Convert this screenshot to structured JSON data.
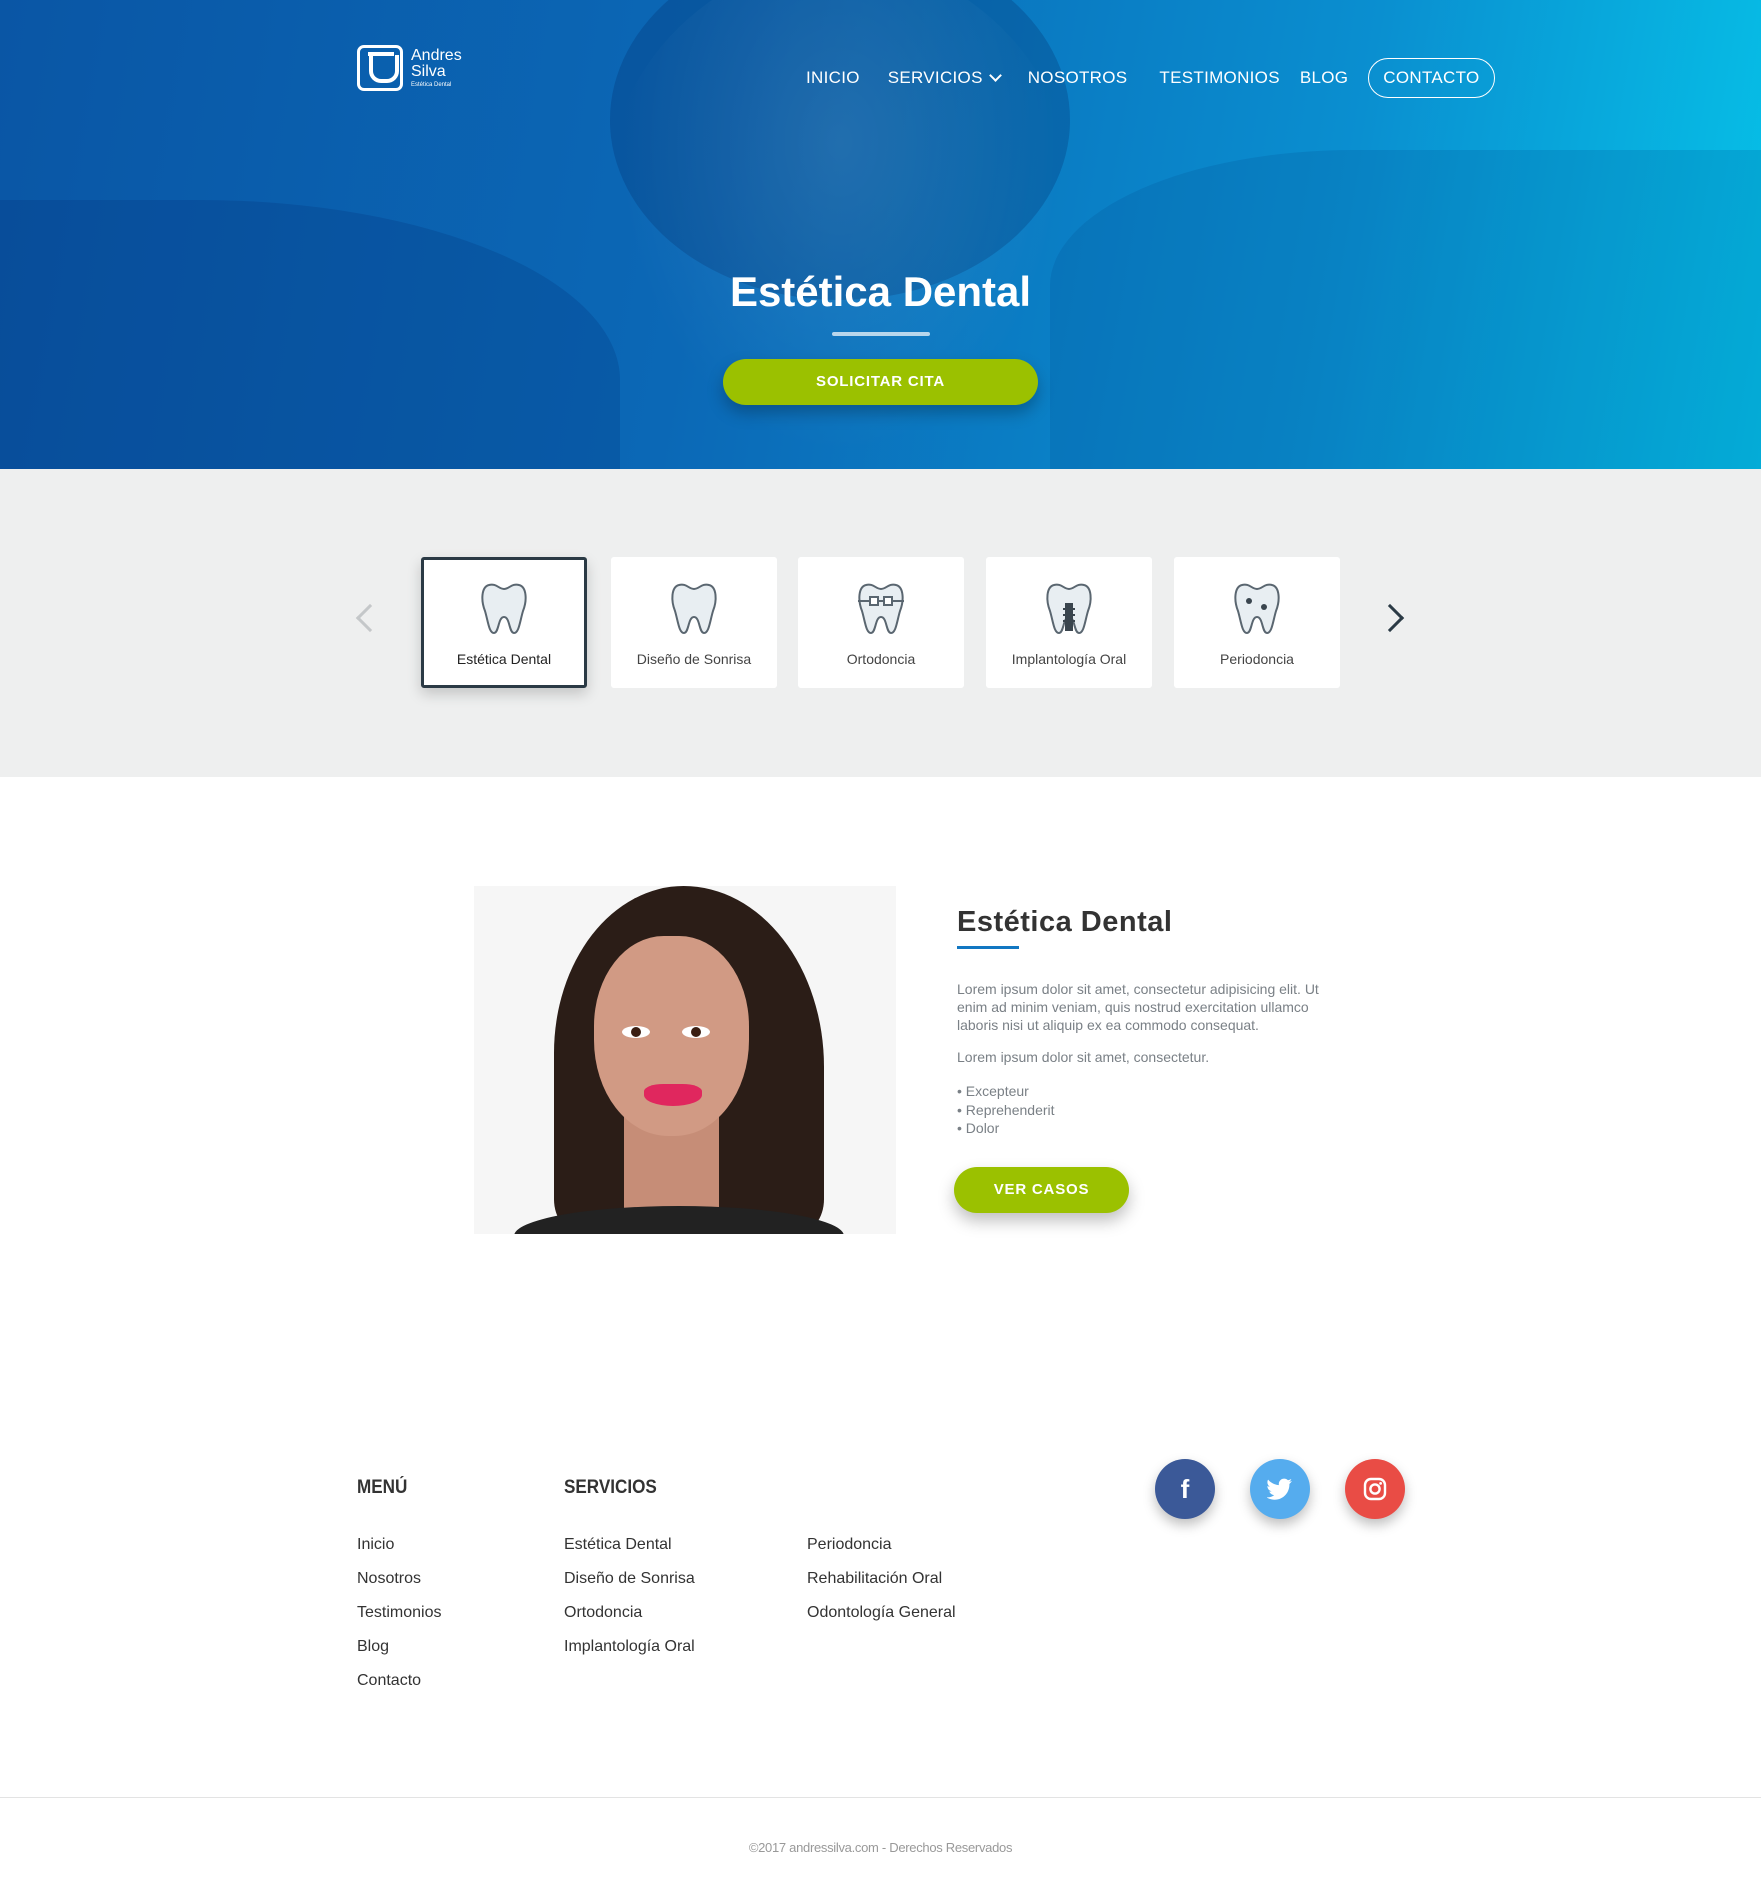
{
  "brand": {
    "line1": "Andres",
    "line2": "Silva",
    "line3": "Estética Dental"
  },
  "nav": {
    "items": [
      "INICIO",
      "SERVICIOS",
      "NOSOTROS",
      "TESTIMONIOS",
      "BLOG"
    ],
    "contact": "CONTACTO"
  },
  "hero": {
    "title": "Estética Dental",
    "button": "SOLICITAR CITA"
  },
  "services": {
    "active_index": 0,
    "cards": [
      {
        "label": "Estética Dental",
        "icon": "tooth-icon"
      },
      {
        "label": "Diseño de Sonrisa",
        "icon": "tooth-icon"
      },
      {
        "label": "Ortodoncia",
        "icon": "braces-tooth-icon"
      },
      {
        "label": "Implantología Oral",
        "icon": "implant-tooth-icon"
      },
      {
        "label": "Periodoncia",
        "icon": "perio-tooth-icon"
      }
    ]
  },
  "content": {
    "title": "Estética Dental",
    "paragraph1": "Lorem ipsum dolor sit amet, consectetur adipisicing elit. Ut enim ad minim veniam, quis nostrud exercitation ullamco laboris nisi ut aliquip ex ea commodo consequat.",
    "paragraph2": "Lorem ipsum dolor sit amet, consectetur.",
    "bullets": [
      "Excepteur",
      "Reprehenderit",
      "Dolor"
    ],
    "button": "VER CASOS"
  },
  "footer": {
    "menu_title": "MENÚ",
    "menu": [
      "Inicio",
      "Nosotros",
      "Testimonios",
      "Blog",
      "Contacto"
    ],
    "services_title": "SERVICIOS",
    "services_col1": [
      "Estética Dental",
      "Diseño de Sonrisa",
      "Ortodoncia",
      "Implantología Oral"
    ],
    "services_col2": [
      "Periodoncia",
      "Rehabilitación Oral",
      "Odontología General"
    ],
    "social": [
      "facebook-icon",
      "twitter-icon",
      "instagram-icon"
    ],
    "copyright": "©2017 andressilva.com - Derechos Reservados"
  },
  "colors": {
    "primary_blue": "#0b68b6",
    "accent_cyan": "#06c2e8",
    "green": "#9bc100",
    "dark": "#2b3a45"
  }
}
